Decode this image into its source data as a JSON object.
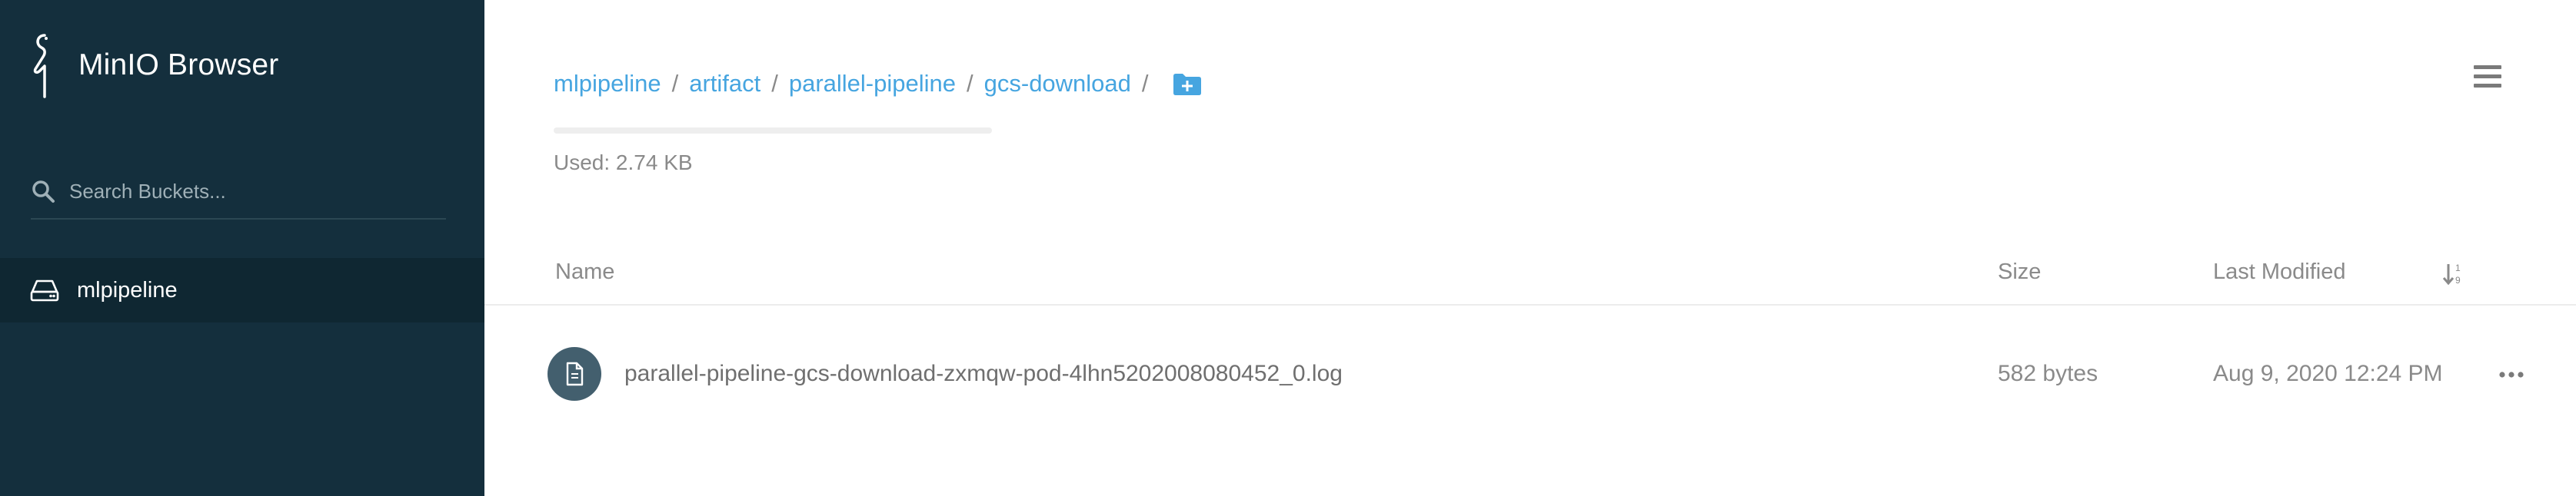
{
  "brand": {
    "title": "MinIO Browser"
  },
  "sidebar": {
    "search": {
      "placeholder": "Search Buckets...",
      "value": ""
    },
    "buckets": [
      {
        "label": "mlpipeline",
        "icon": "drive-icon"
      }
    ]
  },
  "main": {
    "breadcrumb": [
      {
        "label": "mlpipeline"
      },
      {
        "label": "artifact"
      },
      {
        "label": "parallel-pipeline"
      },
      {
        "label": "gcs-download"
      }
    ],
    "separator": "/",
    "usage": {
      "text": "Used: 2.74 KB",
      "fraction": 0.0
    },
    "table": {
      "headers": {
        "name": "Name",
        "size": "Size",
        "modified": "Last Modified"
      },
      "rows": [
        {
          "name": "parallel-pipeline-gcs-download-zxmqw-pod-4lhn5202008080452_0.log",
          "size": "582 bytes",
          "modified": "Aug 9, 2020 12:24 PM",
          "icon": "file-icon"
        }
      ]
    }
  },
  "colors": {
    "sidebar_bg": "#142f3d",
    "sidebar_active": "#0f2732",
    "link": "#46a5e0",
    "muted_text": "#8a8a8a",
    "file_icon_bg": "#435f6e"
  }
}
